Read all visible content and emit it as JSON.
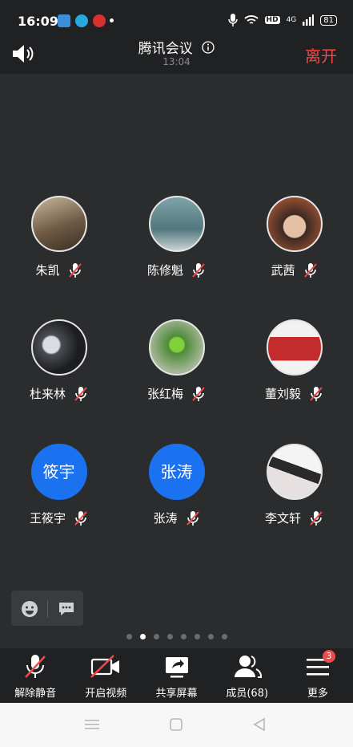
{
  "status_bar": {
    "time": "16:09",
    "battery": "81",
    "network": "4G"
  },
  "header": {
    "title": "腾讯会议",
    "elapsed": "13:04",
    "leave_label": "离开"
  },
  "participants": [
    {
      "name": "朱凯"
    },
    {
      "name": "陈修魁"
    },
    {
      "name": "武茜"
    },
    {
      "name": "杜来林"
    },
    {
      "name": "张红梅"
    },
    {
      "name": "董刘毅"
    },
    {
      "name": "王筱宇",
      "avatar_text": "筱宇"
    },
    {
      "name": "张涛",
      "avatar_text": "张涛"
    },
    {
      "name": "李文轩"
    }
  ],
  "pager": {
    "pages": 8,
    "current": 2
  },
  "toolbar": {
    "unmute_label": "解除静音",
    "video_label": "开启视频",
    "share_label": "共享屏幕",
    "members_label": "成员(68)",
    "more_label": "更多",
    "more_badge": "3"
  },
  "colors": {
    "accent_red": "#ef4a4a",
    "avatar_blue": "#1b72f0",
    "background": "#2b2c2e"
  }
}
